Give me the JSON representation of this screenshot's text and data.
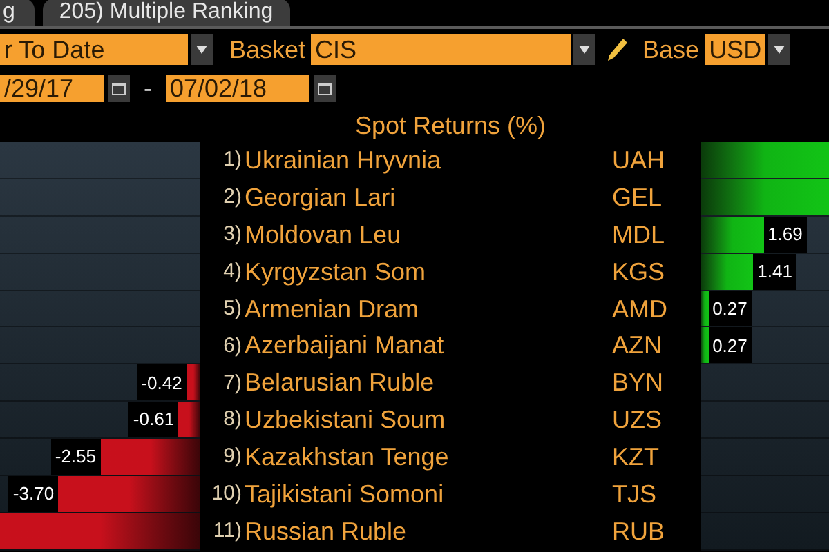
{
  "tabs": [
    {
      "label": "g"
    },
    {
      "label": "205) Multiple Ranking"
    }
  ],
  "controls": {
    "period": {
      "value": "r To Date"
    },
    "basket": {
      "label": "Basket",
      "value": "CIS"
    },
    "base": {
      "label": "Base",
      "value": "USD"
    },
    "start_date": {
      "value": "/29/17"
    },
    "date_separator": "-",
    "end_date": {
      "value": "07/02/18"
    }
  },
  "ranking": {
    "title": "Spot Returns (%)",
    "rows": [
      {
        "rank": "1)",
        "name": "Ukrainian Hryvnia",
        "code": "UAH",
        "kind": "gain",
        "level": 1
      },
      {
        "rank": "2)",
        "name": "Georgian Lari",
        "code": "GEL",
        "kind": "gain",
        "level": 1
      },
      {
        "rank": "3)",
        "name": "Moldovan Leu",
        "code": "MDL",
        "kind": "gain",
        "level": 0.49,
        "value": "1.69"
      },
      {
        "rank": "4)",
        "name": "Kyrgyzstan Som",
        "code": "KGS",
        "kind": "gain",
        "level": 0.41,
        "value": "1.41"
      },
      {
        "rank": "5)",
        "name": "Armenian Dram",
        "code": "AMD",
        "kind": "gain",
        "level": 0.06,
        "value": "0.27"
      },
      {
        "rank": "6)",
        "name": "Azerbaijani Manat",
        "code": "AZN",
        "kind": "gain",
        "level": 0.06,
        "value": "0.27"
      },
      {
        "rank": "7)",
        "name": "Belarusian Ruble",
        "code": "BYN",
        "kind": "loss",
        "level": 0.07,
        "value": "-0.42"
      },
      {
        "rank": "8)",
        "name": "Uzbekistani Soum",
        "code": "UZS",
        "kind": "loss",
        "level": 0.11,
        "value": "-0.61"
      },
      {
        "rank": "9)",
        "name": "Kazakhstan Tenge",
        "code": "KZT",
        "kind": "loss",
        "level": 0.5,
        "value": "-2.55"
      },
      {
        "rank": "10)",
        "name": "Tajikistani Somoni",
        "code": "TJS",
        "kind": "loss",
        "level": 0.71,
        "value": "-3.70"
      },
      {
        "rank": "11)",
        "name": "Russian Ruble",
        "code": "RUB",
        "kind": "loss",
        "level": 1
      }
    ]
  }
}
